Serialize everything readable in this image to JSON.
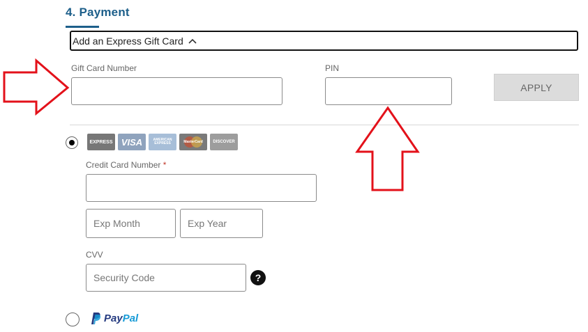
{
  "section": {
    "title": "4. Payment"
  },
  "gift_card": {
    "toggle_label": "Add an Express Gift Card",
    "number_label": "Gift Card Number",
    "number_value": "",
    "pin_label": "PIN",
    "pin_value": "",
    "apply_label": "APPLY"
  },
  "payment_methods": {
    "credit_card": {
      "selected": true,
      "logos": [
        {
          "name": "express-card-logo",
          "text": "EXPRESS"
        },
        {
          "name": "visa-logo",
          "text": "VISA"
        },
        {
          "name": "amex-logo",
          "text": "AMERICAN EXPRESS"
        },
        {
          "name": "mastercard-logo",
          "text": "MasterCard"
        },
        {
          "name": "discover-logo",
          "text": "DISCOVER"
        }
      ],
      "number_label": "Credit Card Number",
      "required_mark": "*",
      "number_value": "",
      "exp_month_placeholder": "Exp Month",
      "exp_year_placeholder": "Exp Year",
      "cvv_label": "CVV",
      "cvv_placeholder": "Security Code",
      "help_icon": "?"
    },
    "paypal": {
      "selected": false,
      "label_pay": "Pay",
      "label_pal": "Pal"
    }
  },
  "colors": {
    "accent": "#1d5f8a",
    "paypal_dark": "#253b80",
    "paypal_light": "#179bd7",
    "annotation_arrow": "#e3111a"
  }
}
